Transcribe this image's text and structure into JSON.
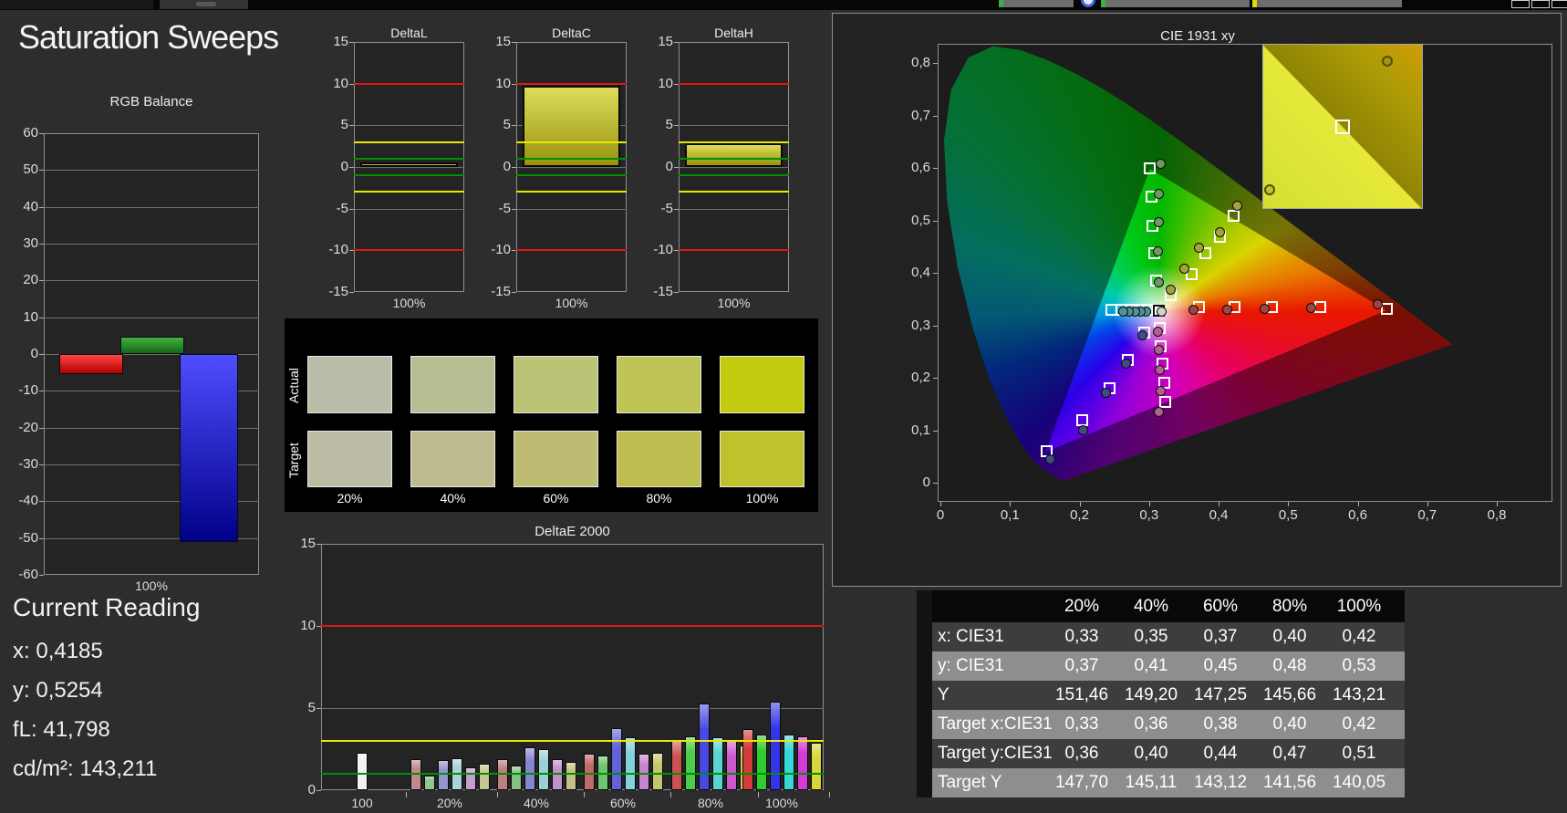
{
  "app": {
    "title": "Saturation Sweeps"
  },
  "toolbar": {
    "fragments": [
      "button-fragment-green-1",
      "sync-icon",
      "button-fragment-green-2",
      "button-fragment-yellow",
      "window-boxes"
    ]
  },
  "colors": {
    "page_bg": "#2d2d2d",
    "panel_bg": "#242424",
    "grid": "#6f6f6f",
    "border": "#909090",
    "limit_red": "#dd1616",
    "limit_yellow": "#e8e800",
    "limit_green": "#009000",
    "delta_bar_top": "#dedc5a",
    "delta_bar_bottom": "#96930f",
    "swatch_panel_bg": "#000000"
  },
  "rgb_balance": {
    "title": "RGB Balance",
    "x_label": "100%",
    "ymin": -60,
    "ymax": 60,
    "ystep": 10,
    "bars": [
      {
        "name": "red",
        "value": -5.5,
        "top": "#ff4545",
        "bottom": "#b30000"
      },
      {
        "name": "green",
        "value": 4.8,
        "top": "#41b041",
        "bottom": "#156815"
      },
      {
        "name": "blue",
        "value": -51,
        "top": "#4e4eff",
        "bottom": "#000089"
      }
    ]
  },
  "delta_axis": {
    "ymin": -15,
    "ymax": 15,
    "ystep": 5,
    "red_line": 10,
    "yellow_line": 3,
    "green_line": 1
  },
  "delta_charts": [
    {
      "title": "DeltaL",
      "x_label": "100%",
      "value": 0.6
    },
    {
      "title": "DeltaC",
      "x_label": "100%",
      "value": 9.7
    },
    {
      "title": "DeltaH",
      "x_label": "100%",
      "value": 2.9
    }
  ],
  "swatches": {
    "row_labels": [
      "Actual",
      "Target"
    ],
    "col_labels": [
      "20%",
      "40%",
      "60%",
      "80%",
      "100%"
    ],
    "actual": [
      "#b8bea7",
      "#b8bd92",
      "#bac376",
      "#bec455",
      "#c3cb0e"
    ],
    "target": [
      "#bcbda4",
      "#bdbc8e",
      "#bebb72",
      "#bfbd50",
      "#c0c22b"
    ]
  },
  "deltae": {
    "title": "DeltaE 2000",
    "ymax": 15,
    "yticks": [
      0,
      5,
      10,
      15
    ],
    "red_line": 10,
    "yellow_line": 3,
    "green_line": 1,
    "groups": [
      {
        "label": "100",
        "values": [
          2.3
        ],
        "colors": [
          "#f2f2f2"
        ]
      },
      {
        "label": "20%",
        "values": [
          1.9,
          0.9,
          1.85,
          1.95,
          1.4,
          1.6
        ],
        "colors": [
          "#c18989",
          "#92c492",
          "#9595cf",
          "#a9d2da",
          "#c79fce",
          "#c6c695"
        ]
      },
      {
        "label": "40%",
        "values": [
          1.9,
          1.5,
          2.6,
          2.5,
          1.9,
          1.75
        ],
        "colors": [
          "#bd7f7f",
          "#85c285",
          "#8585d2",
          "#9cd0d8",
          "#c392ca",
          "#c2c285"
        ]
      },
      {
        "label": "60%",
        "values": [
          2.2,
          2.1,
          3.8,
          3.2,
          2.2,
          2.3
        ],
        "colors": [
          "#c16a6a",
          "#6fc46f",
          "#6262da",
          "#84d2da",
          "#c784cd",
          "#c6c66f"
        ]
      },
      {
        "label": "80%",
        "values": [
          3.0,
          3.3,
          5.3,
          3.2,
          3.0,
          2.7
        ],
        "colors": [
          "#cc5252",
          "#4ccc4c",
          "#4848e2",
          "#58d4d4",
          "#cc58cc",
          "#cccc58"
        ]
      },
      {
        "label": "100%",
        "values": [
          3.7,
          3.4,
          5.4,
          3.4,
          3.3,
          2.9
        ],
        "colors": [
          "#d63b3b",
          "#2ecc2e",
          "#3434e8",
          "#38d6d6",
          "#d63bd6",
          "#d6d63b"
        ]
      }
    ]
  },
  "cie": {
    "title": "CIE 1931 xy",
    "axis_ticks": [
      "0",
      "0,1",
      "0,2",
      "0,3",
      "0,4",
      "0,5",
      "0,6",
      "0,7",
      "0,8"
    ],
    "white_point": {
      "target": [
        0.3127,
        0.329
      ],
      "measured": [
        0.317,
        0.3285
      ],
      "measured_color": "#cdd3cd"
    },
    "sweeps": [
      {
        "name": "red",
        "dot": "#9c4545",
        "targets": [
          [
            0.37,
            0.336
          ],
          [
            0.421,
            0.336
          ],
          [
            0.476,
            0.337
          ],
          [
            0.545,
            0.336
          ],
          [
            0.64,
            0.333
          ]
        ],
        "measured": [
          [
            0.362,
            0.331
          ],
          [
            0.411,
            0.332
          ],
          [
            0.465,
            0.333
          ],
          [
            0.532,
            0.335
          ],
          [
            0.628,
            0.341
          ]
        ]
      },
      {
        "name": "green",
        "dot": "#6f9a63",
        "targets": [
          [
            0.309,
            0.387
          ],
          [
            0.306,
            0.44
          ],
          [
            0.304,
            0.492
          ],
          [
            0.302,
            0.547
          ],
          [
            0.3,
            0.601
          ]
        ],
        "measured": [
          [
            0.313,
            0.384
          ],
          [
            0.312,
            0.443
          ],
          [
            0.313,
            0.498
          ],
          [
            0.313,
            0.553
          ],
          [
            0.316,
            0.609
          ]
        ]
      },
      {
        "name": "blue",
        "dot": "#3f4d85",
        "targets": [
          [
            0.292,
            0.288
          ],
          [
            0.268,
            0.236
          ],
          [
            0.242,
            0.181
          ],
          [
            0.203,
            0.121
          ],
          [
            0.151,
            0.061
          ]
        ],
        "measured": [
          [
            0.289,
            0.282
          ],
          [
            0.265,
            0.229
          ],
          [
            0.237,
            0.173
          ],
          [
            0.204,
            0.102
          ],
          [
            0.157,
            0.046
          ]
        ]
      },
      {
        "name": "cyan",
        "dot": "#53949b",
        "targets": [
          [
            0.297,
            0.332
          ],
          [
            0.285,
            0.332
          ],
          [
            0.273,
            0.332
          ],
          [
            0.259,
            0.332
          ],
          [
            0.245,
            0.332
          ]
        ],
        "measured": [
          [
            0.295,
            0.327
          ],
          [
            0.287,
            0.327
          ],
          [
            0.279,
            0.327
          ],
          [
            0.27,
            0.327
          ],
          [
            0.261,
            0.327
          ]
        ]
      },
      {
        "name": "magenta",
        "dot": "#b25f93",
        "targets": [
          [
            0.314,
            0.296
          ],
          [
            0.316,
            0.262
          ],
          [
            0.318,
            0.228
          ],
          [
            0.32,
            0.192
          ],
          [
            0.322,
            0.156
          ]
        ],
        "measured": [
          [
            0.311,
            0.29
          ],
          [
            0.313,
            0.254
          ],
          [
            0.314,
            0.217
          ],
          [
            0.315,
            0.176
          ],
          [
            0.313,
            0.137
          ]
        ]
      },
      {
        "name": "yellow",
        "dot": "#a3a33f",
        "targets": [
          [
            0.33,
            0.36
          ],
          [
            0.36,
            0.4
          ],
          [
            0.38,
            0.44
          ],
          [
            0.4,
            0.47
          ],
          [
            0.42,
            0.51
          ]
        ],
        "measured": [
          [
            0.33,
            0.37
          ],
          [
            0.35,
            0.41
          ],
          [
            0.37,
            0.45
          ],
          [
            0.4,
            0.48
          ],
          [
            0.425,
            0.53
          ]
        ]
      }
    ],
    "inset": {
      "square": [
        0.5,
        0.5
      ],
      "circles": [
        [
          0.78,
          0.1
        ],
        [
          0.04,
          0.89
        ]
      ]
    }
  },
  "table": {
    "col_headers": [
      "20%",
      "40%",
      "60%",
      "80%",
      "100%"
    ],
    "rows": [
      {
        "label": "x: CIE31",
        "values": [
          "0,33",
          "0,35",
          "0,37",
          "0,40",
          "0,42"
        ]
      },
      {
        "label": "y: CIE31",
        "values": [
          "0,37",
          "0,41",
          "0,45",
          "0,48",
          "0,53"
        ]
      },
      {
        "label": "Y",
        "values": [
          "151,46",
          "149,20",
          "147,25",
          "145,66",
          "143,21"
        ]
      },
      {
        "label": "Target x:CIE31",
        "values": [
          "0,33",
          "0,36",
          "0,38",
          "0,40",
          "0,42"
        ]
      },
      {
        "label": "Target y:CIE31",
        "values": [
          "0,36",
          "0,40",
          "0,44",
          "0,47",
          "0,51"
        ]
      },
      {
        "label": "Target Y",
        "values": [
          "147,70",
          "145,11",
          "143,12",
          "141,56",
          "140,05"
        ]
      }
    ]
  },
  "current_reading": {
    "title": "Current Reading",
    "lines": [
      {
        "label": "x:",
        "value": "0,4185"
      },
      {
        "label": "y:",
        "value": "0,5254"
      },
      {
        "label": "fL:",
        "value": "41,798"
      },
      {
        "label": "cd/m²:",
        "value": "143,211"
      }
    ]
  }
}
